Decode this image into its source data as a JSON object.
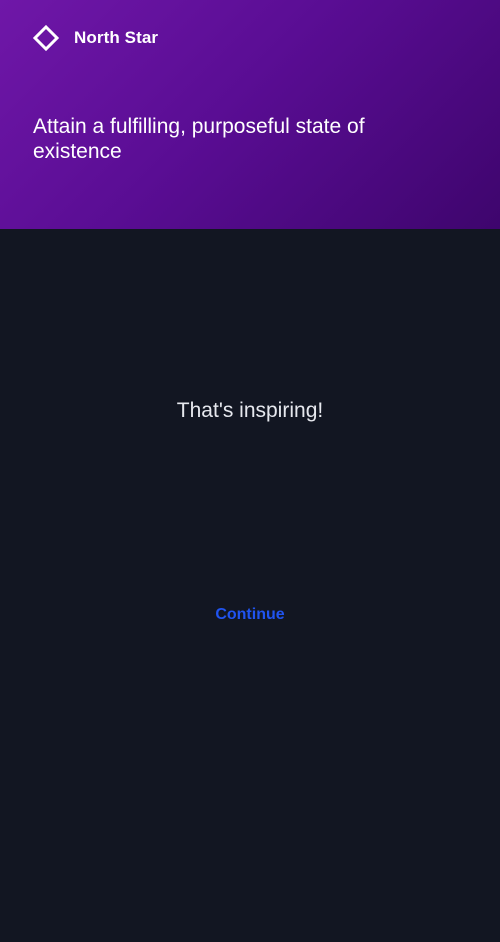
{
  "header": {
    "brand_icon": "diamond-outline-icon",
    "brand_name": "North Star",
    "goal": "Attain a fulfilling, purposeful state of existence",
    "gradient_colors": [
      "#6f17a8",
      "#5a0d94",
      "#3e056d"
    ]
  },
  "main": {
    "message": "That's inspiring!",
    "continue_label": "Continue"
  },
  "colors": {
    "background": "#121622",
    "accent": "#2054f0",
    "text": "#ffffff"
  }
}
